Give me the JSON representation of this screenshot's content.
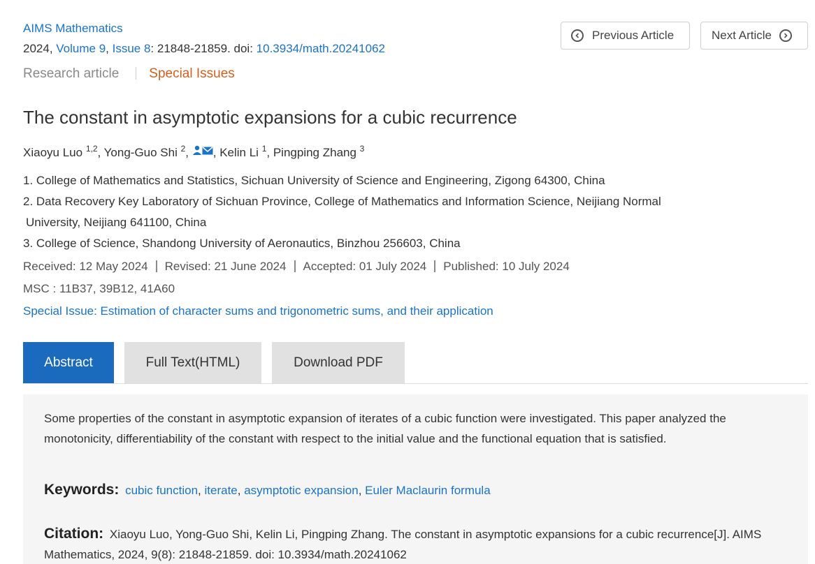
{
  "header": {
    "journal": "AIMS Mathematics",
    "year_prefix": "2024, ",
    "volume": "Volume 9",
    "comma": ", ",
    "issue": "Issue 8",
    "pages_doi_prefix": ": 21848-21859. doi: ",
    "doi": "10.3934/math.20241062",
    "article_type": "Research article",
    "special_issues_link": "Special Issues",
    "prev_article": "Previous Article",
    "next_article": "Next Article"
  },
  "article": {
    "title": "The constant in asymptotic expansions for a cubic recurrence",
    "authors": [
      {
        "name": "Xiaoyu Luo",
        "sup": "1,2"
      },
      {
        "name": "Yong-Guo Shi",
        "sup": "2"
      },
      {
        "name": "Kelin Li",
        "sup": "1"
      },
      {
        "name": "Pingping Zhang",
        "sup": "3"
      }
    ],
    "affiliations": [
      "1. College of Mathematics and Statistics, Sichuan University of Science and Engineering, Zigong 64300, China",
      "2. Data Recovery Key Laboratory of Sichuan Province, College of Mathematics and Information Science, Neijiang Normal",
      "University, Neijiang 641100, China",
      "3. College of Science, Shandong University of Aeronautics, Binzhou 256603, China"
    ],
    "dates": {
      "received": "Received: 12 May 2024",
      "revised": "Revised: 21 June 2024",
      "accepted": "Accepted: 01 July 2024",
      "published": "Published: 10 July 2024"
    },
    "msc": "MSC : 11B37, 39B12, 41A60",
    "special_issue": "Special Issue: Estimation of character sums and trigonometric sums, and their application"
  },
  "tabs": {
    "abstract": "Abstract",
    "full_text": "Full Text(HTML)",
    "download_pdf": "Download PDF"
  },
  "abstract": {
    "text": "Some properties of the constant in asymptotic expansion of iterates of a cubic function were investigated. This paper analyzed the monotonicity, differentiability of the constant with respect to the initial value and the functional equation that is satisfied.",
    "keywords_label": "Keywords:",
    "keywords": [
      "cubic function",
      "iterate",
      "asymptotic expansion",
      "Euler Maclaurin formula"
    ],
    "citation_label": "Citation:",
    "citation": "Xiaoyu Luo, Yong-Guo Shi, Kelin Li, Pingping Zhang. The constant in asymptotic expansions for a cubic recurrence[J]. AIMS Mathematics, 2024, 9(8): 21848-21859. doi: 10.3934/math.20241062"
  },
  "icons": {
    "prev": "chevron-left-circle-icon",
    "next": "chevron-right-circle-icon",
    "person": "person-icon",
    "mail": "mail-icon"
  },
  "colors": {
    "link": "#1a73c9",
    "special": "#d35f1b",
    "active_tab": "#1a6bbd"
  }
}
